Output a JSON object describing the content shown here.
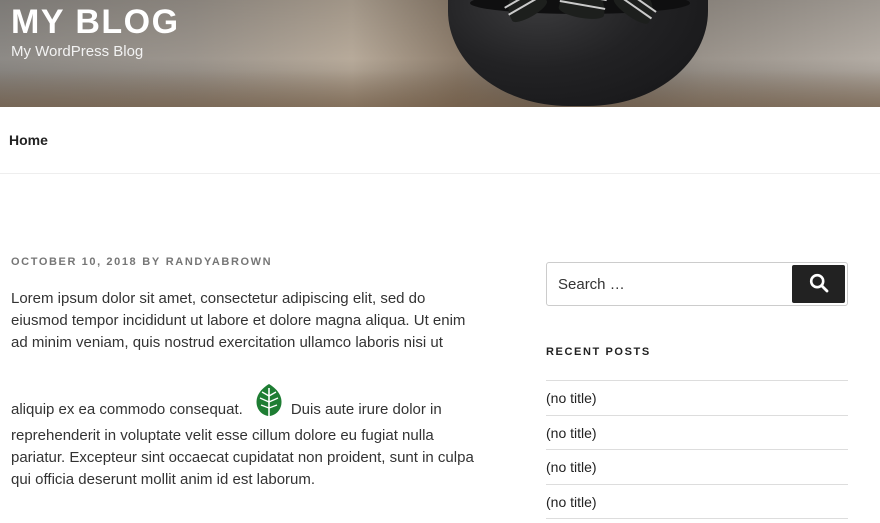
{
  "header": {
    "site_title": "MY BLOG",
    "site_description": "My WordPress Blog"
  },
  "nav": {
    "items": [
      {
        "label": "Home"
      }
    ]
  },
  "post": {
    "date": "OCTOBER 10, 2018",
    "by": "BY",
    "author": "RANDYABROWN",
    "lines": [
      "Lorem ipsum dolor sit amet, consectetur adipiscing elit, sed do",
      "eiusmod tempor incididunt ut labore et dolore magna aliqua. Ut enim",
      "ad minim veniam, quis nostrud exercitation ullamco laboris nisi ut",
      "aliquip ex ea commodo consequat.",
      "Duis aute irure dolor in",
      "reprehenderit in voluptate velit esse cillum dolore eu fugiat nulla",
      "pariatur. Excepteur sint occaecat cupidatat non proident, sunt in culpa",
      "qui officia deserunt mollit anim id est laborum."
    ],
    "inline_icon": "leaf-icon",
    "inline_icon_color": "#1e7d33"
  },
  "sidebar": {
    "search": {
      "placeholder": "Search …",
      "button_icon": "search-icon"
    },
    "recent_posts": {
      "title": "RECENT POSTS",
      "items": [
        {
          "label": "(no title)"
        },
        {
          "label": "(no title)"
        },
        {
          "label": "(no title)"
        },
        {
          "label": "(no title)"
        }
      ]
    }
  },
  "colors": {
    "accent": "#222222",
    "text": "#333333",
    "meta": "#767676"
  }
}
